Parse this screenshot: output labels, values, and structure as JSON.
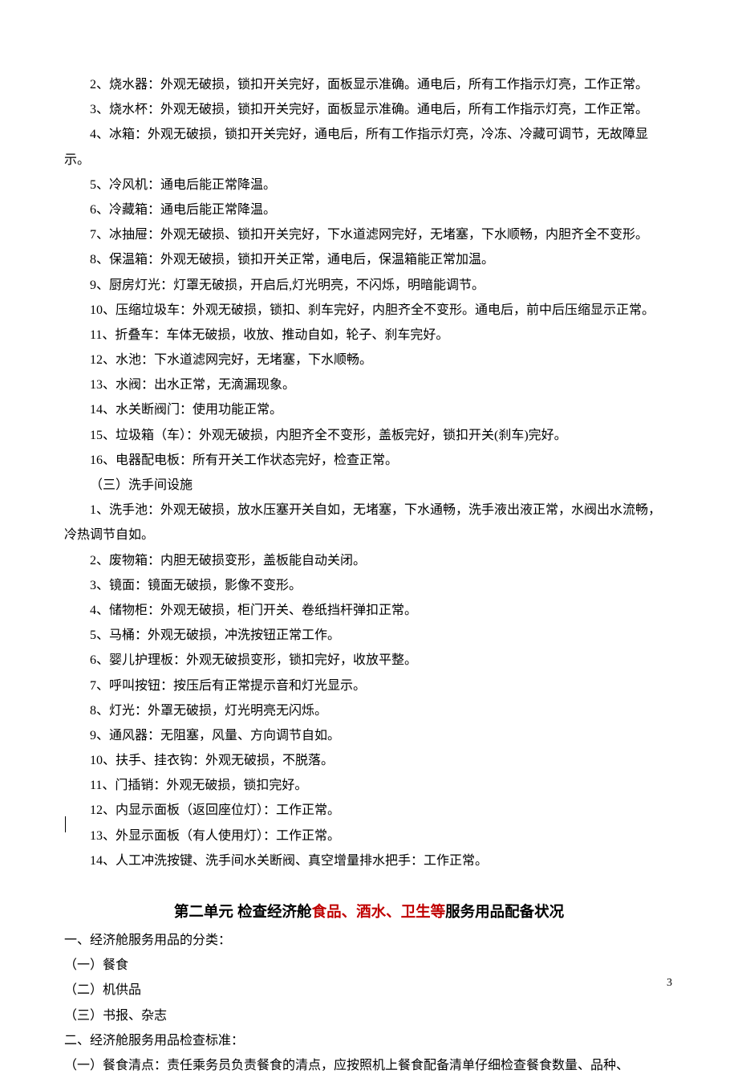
{
  "body_lines": [
    "2、烧水器：外观无破损，锁扣开关完好，面板显示准确。通电后，所有工作指示灯亮，工作正常。",
    "3、烧水杯：外观无破损，锁扣开关完好，面板显示准确。通电后，所有工作指示灯亮，工作正常。"
  ],
  "line4a": "4、冰箱：外观无破损，锁扣开关完好，通电后，所有工作指示灯亮，冷冻、冷藏可调节，无故障显",
  "line4b": "示。",
  "mid_lines": [
    "5、冷风机：通电后能正常降温。",
    "6、冷藏箱：通电后能正常降温。",
    "7、冰抽屉：外观无破损、锁扣开关完好，下水道滤网完好，无堵塞，下水顺畅，内胆齐全不变形。",
    "8、保温箱：外观无破损，锁扣开关正常，通电后，保温箱能正常加温。",
    "9、厨房灯光：灯罩无破损，开启后,灯光明亮，不闪烁，明暗能调节。",
    "10、压缩垃圾车：外观无破损，锁扣、刹车完好，内胆齐全不变形。通电后，前中后压缩显示正常。",
    "11、折叠车：车体无破损，收放、推动自如，轮子、刹车完好。",
    "12、水池：下水道滤网完好，无堵塞，下水顺畅。",
    "13、水阀：出水正常，无滴漏现象。",
    "14、水关断阀门：使用功能正常。",
    "15、垃圾箱（车）：外观无破损，内胆齐全不变形，盖板完好，锁扣开关(刹车)完好。",
    "16、电器配电板：所有开关工作状态完好，检查正常。",
    "（三）洗手间设施"
  ],
  "wash1a": "1、洗手池：外观无破损，放水压塞开关自如，无堵塞，下水通畅，洗手液出液正常，水阀出水流畅，",
  "wash1b": "冷热调节自如。",
  "wash_lines": [
    "2、废物箱：内胆无破损变形，盖板能自动关闭。",
    "3、镜面：镜面无破损，影像不变形。",
    "4、储物柜：外观无破损，柜门开关、卷纸挡杆弹扣正常。",
    "5、马桶：外观无破损，冲洗按钮正常工作。",
    "6、婴儿护理板：外观无破损变形，锁扣完好，收放平整。",
    "7、呼叫按钮：按压后有正常提示音和灯光显示。",
    "8、灯光：外罩无破损，灯光明亮无闪烁。",
    "9、通风器：无阻塞，风量、方向调节自如。",
    "10、扶手、挂衣钩：外观无破损，不脱落。",
    "11、门插销：外观无破损，锁扣完好。",
    "12、内显示面板（返回座位灯）：工作正常。",
    "13、外显示面板（有人使用灯）：工作正常。",
    "14、人工冲洗按键、洗手间水关断阀、真空增量排水把手：工作正常。"
  ],
  "title": {
    "p1": "第二单元  检查经济舱",
    "p2": "食品、酒水、卫生等",
    "p3": "服务用品配备状况"
  },
  "section2_lines": [
    "一、经济舱服务用品的分类：",
    "（一）餐食",
    "（二）机供品",
    "（三）书报、杂志",
    "二、经济舱服务用品检查标准：",
    "（一）餐食清点：责任乘务员负责餐食的清点，应按照机上餐食配备清单仔细检查餐食数量、品种、"
  ],
  "page_number": "3"
}
